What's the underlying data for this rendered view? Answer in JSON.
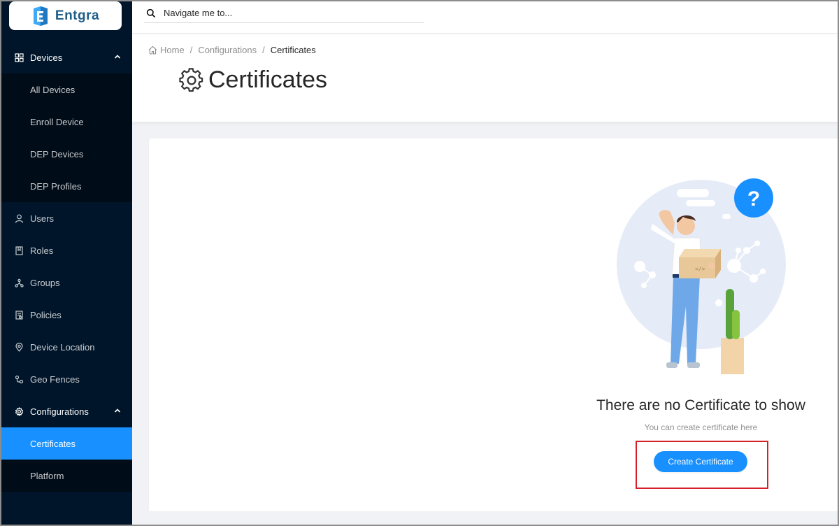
{
  "app": {
    "logo_text": "Entgra"
  },
  "search": {
    "placeholder": "Navigate me to..."
  },
  "sidebar": {
    "devices": {
      "label": "Devices",
      "items": [
        "All Devices",
        "Enroll Device",
        "DEP Devices",
        "DEP Profiles"
      ]
    },
    "items": [
      "Users",
      "Roles",
      "Groups",
      "Policies",
      "Device Location",
      "Geo Fences"
    ],
    "configurations": {
      "label": "Configurations",
      "items": [
        "Certificates",
        "Platform"
      ]
    }
  },
  "breadcrumb": {
    "home": "Home",
    "configurations": "Configurations",
    "current": "Certificates",
    "separator": "/"
  },
  "page": {
    "title": "Certificates"
  },
  "empty": {
    "title": "There are no Certificate to show",
    "subtitle": "You can create certificate here",
    "button_label": "Create Certificate",
    "question_mark": "?"
  },
  "colors": {
    "sidebar": "#001529",
    "submenu": "#000c17",
    "accent": "#1890ff",
    "highlight": "#d32029"
  },
  "icons": [
    "search-icon",
    "grid-icon",
    "chevron-up-icon",
    "user-icon",
    "book-icon",
    "cluster-icon",
    "file-icon",
    "location-icon",
    "geo-fence-icon",
    "gear-icon",
    "home-icon"
  ]
}
